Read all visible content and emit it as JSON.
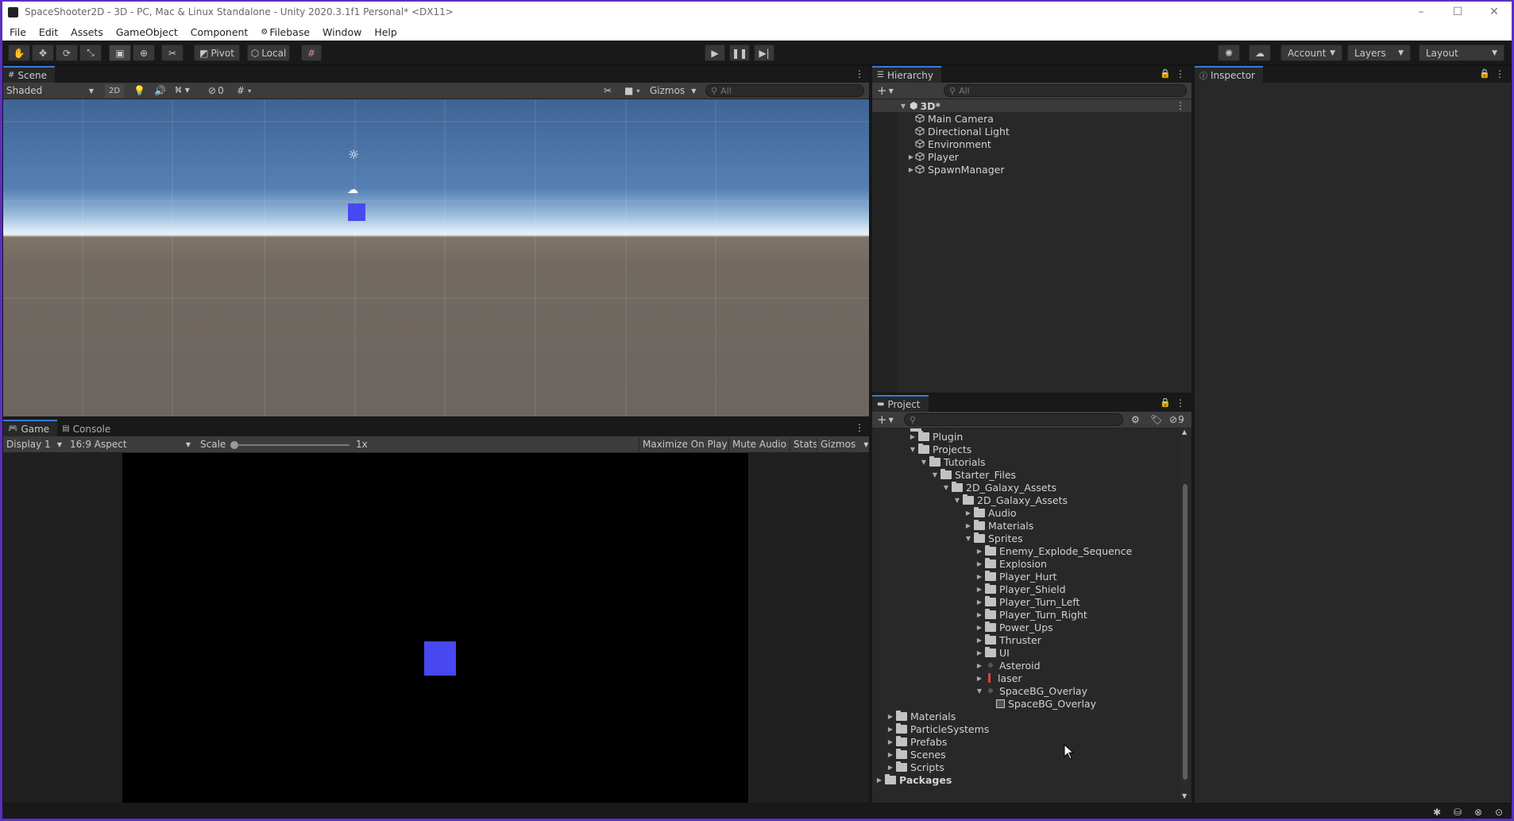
{
  "window": {
    "title": "SpaceShooter2D - 3D - PC, Mac & Linux Standalone - Unity 2020.3.1f1 Personal* <DX11>",
    "controls": [
      "–",
      "☐",
      "✕"
    ]
  },
  "menu": [
    "File",
    "Edit",
    "Assets",
    "GameObject",
    "Component",
    "Filebase",
    "Window",
    "Help"
  ],
  "toolbar": {
    "pivot": "Pivot",
    "local": "Local",
    "account": "Account",
    "layers": "Layers",
    "layout": "Layout"
  },
  "scene": {
    "tab": "Scene",
    "shading": "Shaded",
    "mode_2d": "2D",
    "hidden_count": "0",
    "gizmos": "Gizmos",
    "search_placeholder": "All"
  },
  "game": {
    "tabs": [
      "Game",
      "Console"
    ],
    "display": "Display 1",
    "aspect": "16:9 Aspect",
    "scale_label": "Scale",
    "scale_value": "1x",
    "scale_fraction": 0,
    "maximize": "Maximize On Play",
    "mute": "Mute Audio",
    "stats": "Stats",
    "gizmos": "Gizmos"
  },
  "hierarchy": {
    "tab": "Hierarchy",
    "search_placeholder": "All",
    "scene_name": "3D*",
    "items": [
      {
        "label": "Main Camera",
        "expandable": false
      },
      {
        "label": "Directional Light",
        "expandable": false
      },
      {
        "label": "Environment",
        "expandable": false
      },
      {
        "label": "Player",
        "expandable": true
      },
      {
        "label": "SpawnManager",
        "expandable": true
      }
    ]
  },
  "inspector": {
    "tab": "Inspector"
  },
  "project": {
    "tab": "Project",
    "hidden_count": "9",
    "tree": [
      {
        "label": "Plugin",
        "depth": 3,
        "state": "collapsed",
        "kind": "folder"
      },
      {
        "label": "Projects",
        "depth": 3,
        "state": "expanded",
        "kind": "folder"
      },
      {
        "label": "Tutorials",
        "depth": 4,
        "state": "expanded",
        "kind": "folder"
      },
      {
        "label": "Starter_Files",
        "depth": 5,
        "state": "expanded",
        "kind": "folder"
      },
      {
        "label": "2D_Galaxy_Assets",
        "depth": 6,
        "state": "expanded",
        "kind": "folder"
      },
      {
        "label": "2D_Galaxy_Assets",
        "depth": 7,
        "state": "expanded",
        "kind": "folder"
      },
      {
        "label": "Audio",
        "depth": 8,
        "state": "collapsed",
        "kind": "folder"
      },
      {
        "label": "Materials",
        "depth": 8,
        "state": "collapsed",
        "kind": "folder"
      },
      {
        "label": "Sprites",
        "depth": 8,
        "state": "expanded",
        "kind": "folder"
      },
      {
        "label": "Enemy_Explode_Sequence",
        "depth": 9,
        "state": "collapsed",
        "kind": "folder"
      },
      {
        "label": "Explosion",
        "depth": 9,
        "state": "collapsed",
        "kind": "folder"
      },
      {
        "label": "Player_Hurt",
        "depth": 9,
        "state": "collapsed",
        "kind": "folder"
      },
      {
        "label": "Player_Shield",
        "depth": 9,
        "state": "collapsed",
        "kind": "folder"
      },
      {
        "label": "Player_Turn_Left",
        "depth": 9,
        "state": "collapsed",
        "kind": "folder"
      },
      {
        "label": "Player_Turn_Right",
        "depth": 9,
        "state": "collapsed",
        "kind": "folder"
      },
      {
        "label": "Power_Ups",
        "depth": 9,
        "state": "collapsed",
        "kind": "folder"
      },
      {
        "label": "Thruster",
        "depth": 9,
        "state": "collapsed",
        "kind": "folder"
      },
      {
        "label": "UI",
        "depth": 9,
        "state": "collapsed",
        "kind": "folder"
      },
      {
        "label": "Asteroid",
        "depth": 9,
        "state": "collapsed",
        "kind": "sprite"
      },
      {
        "label": "laser",
        "depth": 9,
        "state": "collapsed",
        "kind": "laser"
      },
      {
        "label": "SpaceBG_Overlay",
        "depth": 9,
        "state": "expanded",
        "kind": "sprite"
      },
      {
        "label": "SpaceBG_Overlay",
        "depth": 10,
        "state": "none",
        "kind": "subsprite"
      },
      {
        "label": "Materials",
        "depth": 1,
        "state": "collapsed",
        "kind": "folder"
      },
      {
        "label": "ParticleSystems",
        "depth": 1,
        "state": "collapsed",
        "kind": "folder"
      },
      {
        "label": "Prefabs",
        "depth": 1,
        "state": "collapsed",
        "kind": "folder"
      },
      {
        "label": "Scenes",
        "depth": 1,
        "state": "collapsed",
        "kind": "folder"
      },
      {
        "label": "Scripts",
        "depth": 1,
        "state": "collapsed",
        "kind": "folder"
      },
      {
        "label": "Packages",
        "depth": 0,
        "state": "collapsed",
        "kind": "folder-bold"
      }
    ]
  },
  "colors": {
    "accent": "#3a7bd5",
    "cube": "#4848f0"
  }
}
